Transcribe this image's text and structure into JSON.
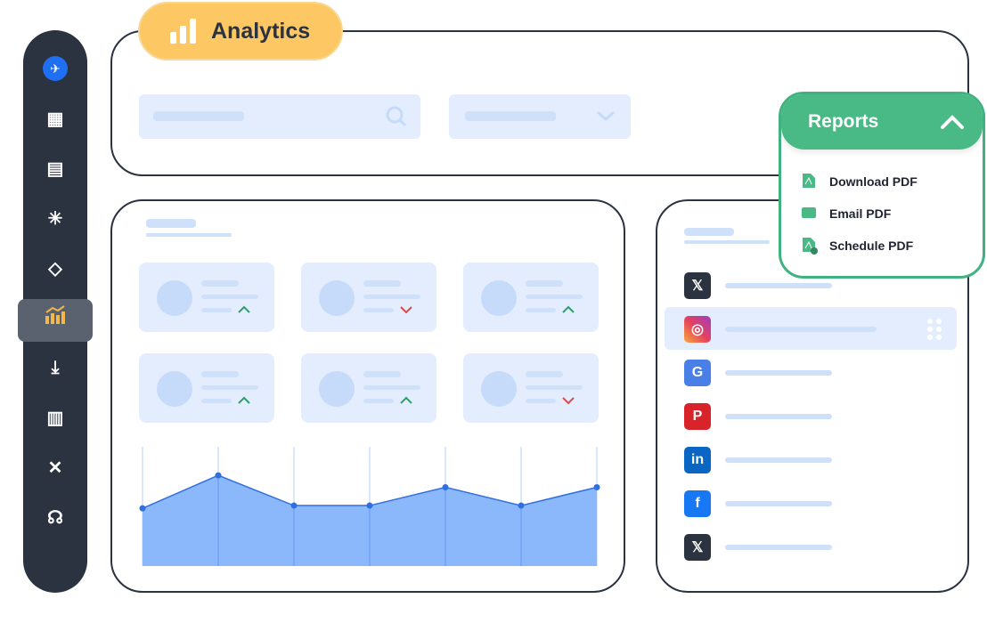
{
  "header": {
    "title": "Analytics",
    "icon": "bar-chart-icon"
  },
  "sidebar": {
    "items": [
      {
        "icon": "paper-plane-logo-icon"
      },
      {
        "icon": "dashboard-icon"
      },
      {
        "icon": "feedback-icon"
      },
      {
        "icon": "network-icon"
      },
      {
        "icon": "workflow-icon"
      },
      {
        "icon": "analytics-icon",
        "active": true
      },
      {
        "icon": "inbox-download-icon"
      },
      {
        "icon": "library-icon"
      },
      {
        "icon": "tools-icon"
      },
      {
        "icon": "headset-icon"
      }
    ],
    "active_color": "#f2b84b"
  },
  "reports": {
    "title": "Reports",
    "items": [
      {
        "label": "Download PDF",
        "icon": "pdf-icon"
      },
      {
        "label": "Email PDF",
        "icon": "email-icon"
      },
      {
        "label": "Schedule PDF",
        "icon": "schedule-pdf-icon"
      }
    ],
    "accent": "#49b985"
  },
  "stats": [
    {
      "trend": "up"
    },
    {
      "trend": "down"
    },
    {
      "trend": "up"
    },
    {
      "trend": "up"
    },
    {
      "trend": "up"
    },
    {
      "trend": "down"
    }
  ],
  "social": [
    {
      "icon": "x-icon",
      "selected": false
    },
    {
      "icon": "instagram-icon",
      "selected": true
    },
    {
      "icon": "google-business-icon",
      "selected": false
    },
    {
      "icon": "pinterest-icon",
      "selected": false
    },
    {
      "icon": "linkedin-icon",
      "selected": false
    },
    {
      "icon": "facebook-icon",
      "selected": false
    },
    {
      "icon": "x-icon",
      "selected": false
    }
  ],
  "chart_data": {
    "type": "area",
    "values": [
      63,
      99,
      66,
      66,
      86,
      66,
      86
    ],
    "ylim": [
      0,
      136
    ],
    "color": "#8bb8fb",
    "line": "#2f6fe0"
  }
}
